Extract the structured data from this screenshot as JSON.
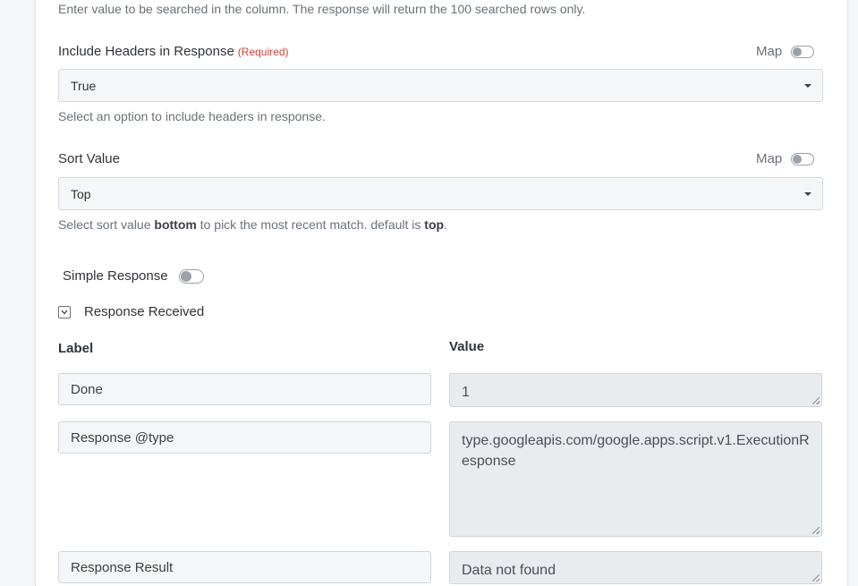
{
  "search_help": "Enter value to be searched in the column. The response will return the 100 searched rows only.",
  "include_headers": {
    "label": "Include Headers in Response",
    "required": "(Required)",
    "map_label": "Map",
    "value": "True",
    "help": "Select an option to include headers in response."
  },
  "sort_value": {
    "label": "Sort Value",
    "map_label": "Map",
    "value": "Top",
    "help_prefix": "Select sort value ",
    "help_bold1": "bottom",
    "help_middle": " to pick the most recent match. default is ",
    "help_bold2": "top",
    "help_suffix": "."
  },
  "simple_response": {
    "label": "Simple Response"
  },
  "response_received": {
    "label": "Response Received"
  },
  "table": {
    "label_header": "Label",
    "value_header": "Value",
    "rows": [
      {
        "label": "Done",
        "value": "1"
      },
      {
        "label": "Response @type",
        "value": "type.googleapis.com/google.apps.script.v1.ExecutionResponse"
      },
      {
        "label": "Response Result",
        "value": "Data not found"
      }
    ]
  }
}
